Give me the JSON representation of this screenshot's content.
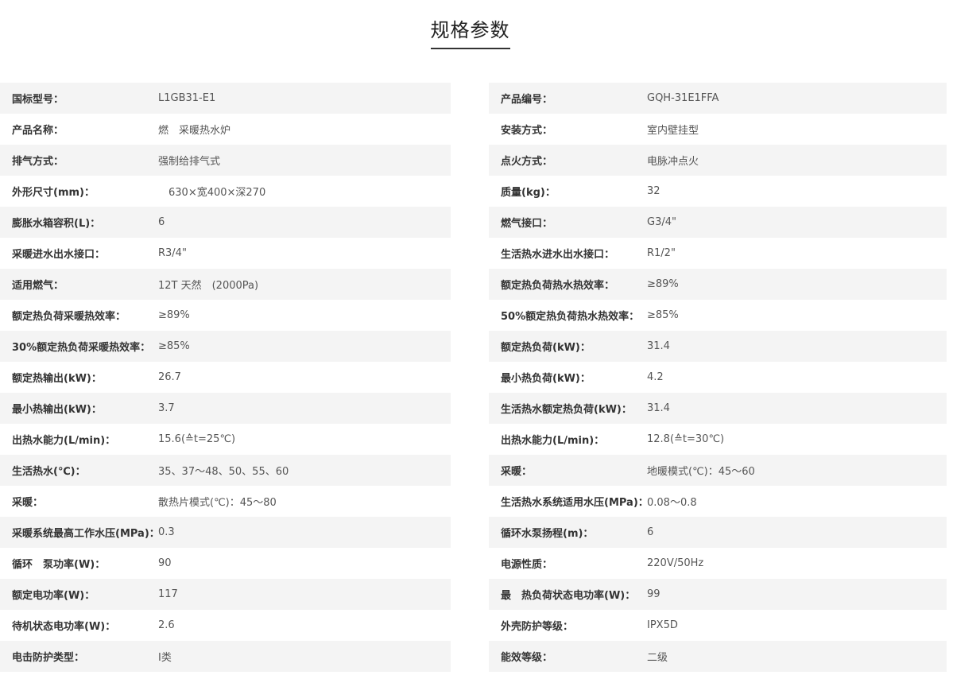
{
  "title": "规格参数",
  "left_rows": [
    {
      "label": "国标型号：",
      "value": "L1GB31-E1"
    },
    {
      "label": "产品名称：",
      "value": "燃　采暖热水炉"
    },
    {
      "label": "排气方式：",
      "value": "强制给排气式"
    },
    {
      "label": "外形尺寸(mm)：",
      "value": "　630×宽400×深270"
    },
    {
      "label": "膨胀水箱容积(L)：",
      "value": "6"
    },
    {
      "label": "采暖进水出水接口：",
      "value": "R3/4\""
    },
    {
      "label": "适用燃气：",
      "value": "12T 天然　(2000Pa)"
    },
    {
      "label": "额定热负荷采暖热效率：",
      "value": "≥89%"
    },
    {
      "label": "30%额定热负荷采暖热效率：",
      "value": "≥85%"
    },
    {
      "label": "额定热输出(kW)：",
      "value": "26.7"
    },
    {
      "label": "最小热输出(kW)：",
      "value": "3.7"
    },
    {
      "label": "出热水能力(L/min)：",
      "value": "15.6(≙t=25℃)"
    },
    {
      "label": "生活热水(℃)：",
      "value": "35、37〜48、50、55、60"
    },
    {
      "label": "采暖：",
      "value": "散热片模式(℃)：45〜80"
    },
    {
      "label": "采暖系统最高工作水压(MPa)：",
      "value": "0.3"
    },
    {
      "label": "循环　泵功率(W)：",
      "value": "90"
    },
    {
      "label": "额定电功率(W)：",
      "value": "117"
    },
    {
      "label": "待机状态电功率(W)：",
      "value": "2.6"
    },
    {
      "label": "电击防护类型：",
      "value": "I类"
    }
  ],
  "right_rows": [
    {
      "label": "产品编号：",
      "value": "GQH-31E1FFA"
    },
    {
      "label": "安装方式：",
      "value": "室内壁挂型"
    },
    {
      "label": "点火方式：",
      "value": "电脉冲点火"
    },
    {
      "label": "质量(kg)：",
      "value": "32"
    },
    {
      "label": "燃气接口：",
      "value": "G3/4\""
    },
    {
      "label": "生活热水进水出水接口：",
      "value": "R1/2\""
    },
    {
      "label": "额定热负荷热水热效率：",
      "value": "≥89%"
    },
    {
      "label": "50%额定热负荷热水热效率：",
      "value": "≥85%"
    },
    {
      "label": "额定热负荷(kW)：",
      "value": "31.4"
    },
    {
      "label": "最小热负荷(kW)：",
      "value": "4.2"
    },
    {
      "label": "生活热水额定热负荷(kW)：",
      "value": "31.4"
    },
    {
      "label": "出热水能力(L/min)：",
      "value": "12.8(≙t=30℃)"
    },
    {
      "label": "采暖：",
      "value": "地暖模式(℃)：45〜60"
    },
    {
      "label": "生活热水系统适用水压(MPa)：",
      "value": "0.08〜0.8"
    },
    {
      "label": "循环水泵扬程(m)：",
      "value": "6"
    },
    {
      "label": "电源性质：",
      "value": "220V/50Hz"
    },
    {
      "label": "最　热负荷状态电功率(W)：",
      "value": "99"
    },
    {
      "label": "外壳防护等级：",
      "value": "IPX5D"
    },
    {
      "label": "能效等级：",
      "value": "二级"
    }
  ]
}
